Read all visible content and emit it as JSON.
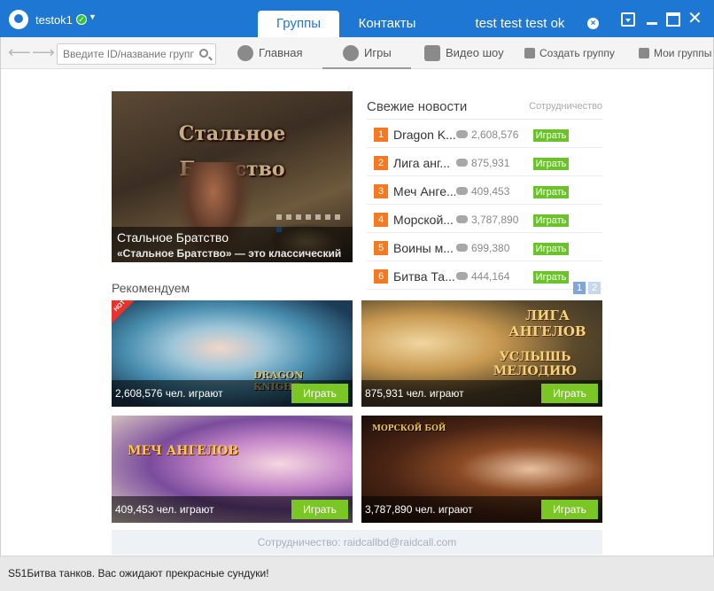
{
  "titlebar": {
    "username": "testok1",
    "tabs": [
      {
        "label": "Группы",
        "active": true
      },
      {
        "label": "Контакты",
        "active": false
      },
      {
        "label": "test test test ok",
        "active": false
      }
    ],
    "accent": "#1f77d4"
  },
  "toolbar": {
    "search_placeholder": "Введите ID/название группы",
    "home_label": "Главная",
    "games_label": "Игры",
    "video_label": "Видео шоу",
    "create_label": "Создать группу",
    "my_groups_label": "Мои группы"
  },
  "banner": {
    "logo_text": "Стальное Братство",
    "title": "Стальное Братство",
    "description": "«Стальное Братство» — это классический",
    "slide_count": 8,
    "active_slide": 8
  },
  "news": {
    "title": "Свежие новости",
    "coop": "Сотрудничество",
    "items": [
      {
        "rank": "1",
        "name": "Dragon K...",
        "count": "2,608,576",
        "play": "Играть"
      },
      {
        "rank": "2",
        "name": "Лига анг...",
        "count": "875,931",
        "play": "Играть"
      },
      {
        "rank": "3",
        "name": "Меч Анге...",
        "count": "409,453",
        "play": "Играть"
      },
      {
        "rank": "4",
        "name": "Морской...",
        "count": "3,787,890",
        "play": "Играть"
      },
      {
        "rank": "5",
        "name": "Воины м...",
        "count": "699,380",
        "play": "Играть"
      },
      {
        "rank": "6",
        "name": "Битва Та...",
        "count": "444,164",
        "play": "Играть"
      }
    ],
    "pages": [
      "1",
      "2"
    ]
  },
  "recommend": {
    "title": "Рекомендуем",
    "cards": [
      {
        "count": "2,608,576 чел. играют",
        "button": "Играть",
        "logo": "DRAGON KNIGHT",
        "badge": "HOT"
      },
      {
        "count": "875,931 чел. играют",
        "button": "Играть",
        "logo": "ЛИГА АНГЕЛОВ",
        "logo2": "УСЛЫШЬ МЕЛОДИЮ"
      },
      {
        "count": "409,453 чел. играют",
        "button": "Играть",
        "logo": "МЕЧ АНГЕЛОВ"
      },
      {
        "count": "3,787,890 чел. играют",
        "button": "Играть",
        "logo": "МОРСКОЙ БОЙ"
      }
    ]
  },
  "footer": {
    "coop": "Сотрудничество: raidcallbd@raidcall.com"
  },
  "statusbar": {
    "text": "S51Битва танков. Вас ожидают прекрасные сундуки!"
  }
}
